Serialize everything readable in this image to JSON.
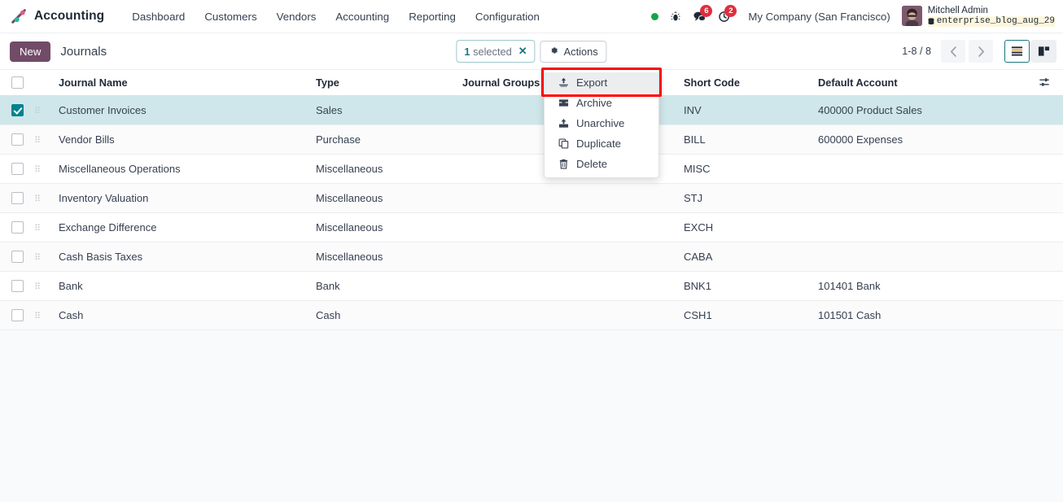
{
  "navbar": {
    "brand": "Accounting",
    "logo_icon": "odoo-logo",
    "menu": [
      {
        "label": "Dashboard"
      },
      {
        "label": "Customers"
      },
      {
        "label": "Vendors"
      },
      {
        "label": "Accounting"
      },
      {
        "label": "Reporting"
      },
      {
        "label": "Configuration"
      }
    ],
    "status_dot_icon": "online-status-dot",
    "bug_icon": "bug-icon",
    "messages_icon": "chat-bubble-icon",
    "messages_count": "6",
    "activity_icon": "clock-activity-icon",
    "activity_count": "2",
    "company": "My Company (San Francisco)",
    "user_name": "Mitchell Admin",
    "database_icon": "database-icon",
    "database": "enterprise_blog_aug_29"
  },
  "control_panel": {
    "new_label": "New",
    "breadcrumb": "Journals",
    "selected_count": "1",
    "selected_label": "selected",
    "clear_selection_icon": "close-x-icon",
    "actions_icon": "gear-icon",
    "actions_label": "Actions",
    "pager": "1-8 / 8",
    "prev_icon": "chevron-left-icon",
    "next_icon": "chevron-right-icon",
    "view_list_icon": "list-view-icon",
    "view_kanban_icon": "kanban-view-icon"
  },
  "actions_menu": {
    "items": [
      {
        "label": "Export",
        "icon": "export-upload-icon",
        "highlighted": true
      },
      {
        "label": "Archive",
        "icon": "archive-box-icon",
        "highlighted": false
      },
      {
        "label": "Unarchive",
        "icon": "unarchive-upload-icon",
        "highlighted": false
      },
      {
        "label": "Duplicate",
        "icon": "duplicate-copy-icon",
        "highlighted": false
      },
      {
        "label": "Delete",
        "icon": "trash-delete-icon",
        "highlighted": false
      }
    ]
  },
  "table": {
    "columns": [
      "Journal Name",
      "Type",
      "Journal Groups",
      "Short Code",
      "Default Account"
    ],
    "optional_columns_icon": "column-settings-icon",
    "rows": [
      {
        "selected": true,
        "name": "Customer Invoices",
        "type": "Sales",
        "groups": "",
        "short": "INV",
        "account": "400000 Product Sales"
      },
      {
        "selected": false,
        "name": "Vendor Bills",
        "type": "Purchase",
        "groups": "",
        "short": "BILL",
        "account": "600000 Expenses"
      },
      {
        "selected": false,
        "name": "Miscellaneous Operations",
        "type": "Miscellaneous",
        "groups": "",
        "short": "MISC",
        "account": ""
      },
      {
        "selected": false,
        "name": "Inventory Valuation",
        "type": "Miscellaneous",
        "groups": "",
        "short": "STJ",
        "account": ""
      },
      {
        "selected": false,
        "name": "Exchange Difference",
        "type": "Miscellaneous",
        "groups": "",
        "short": "EXCH",
        "account": ""
      },
      {
        "selected": false,
        "name": "Cash Basis Taxes",
        "type": "Miscellaneous",
        "groups": "",
        "short": "CABA",
        "account": ""
      },
      {
        "selected": false,
        "name": "Bank",
        "type": "Bank",
        "groups": "",
        "short": "BNK1",
        "account": "101401 Bank"
      },
      {
        "selected": false,
        "name": "Cash",
        "type": "Cash",
        "groups": "",
        "short": "CSH1",
        "account": "101501 Cash"
      }
    ]
  },
  "colors": {
    "primary": "#714b67",
    "accent": "#17787f",
    "selected_row": "#cfe7ea",
    "badge": "#e02e3d",
    "highlight_box": "#ff0000"
  }
}
